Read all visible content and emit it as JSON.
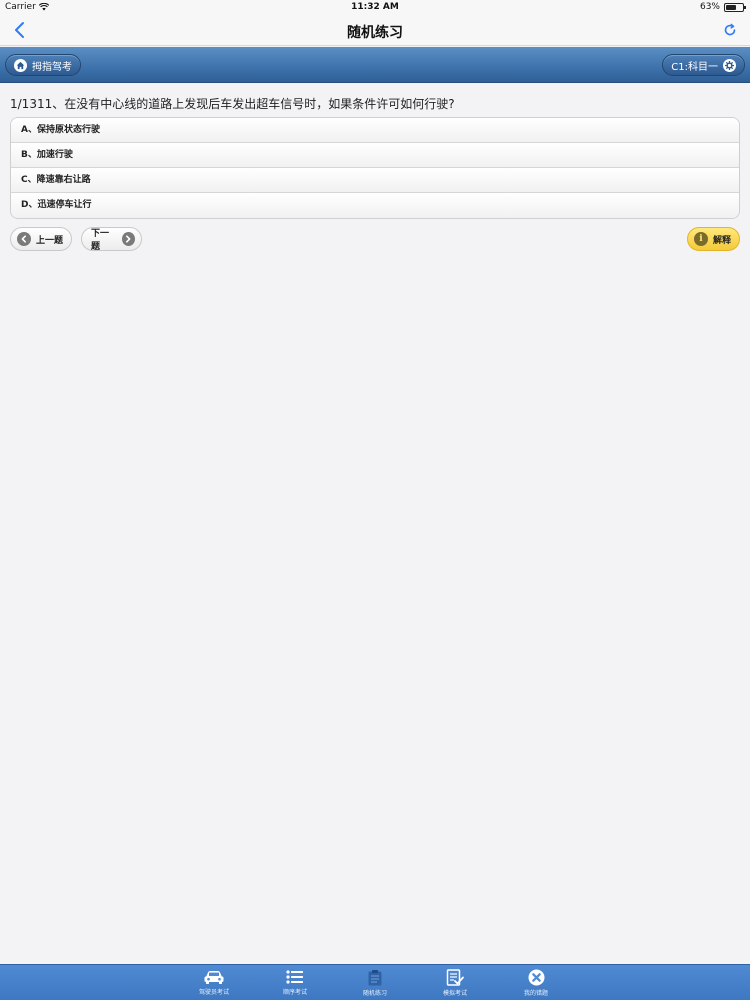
{
  "status": {
    "carrier": "Carrier",
    "time": "11:32 AM",
    "battery_text": "63%",
    "battery_level": 0.63
  },
  "nav": {
    "title": "随机练习"
  },
  "header": {
    "left_label": "拇指驾考",
    "right_label": "C1:科目一"
  },
  "question": {
    "text": "1/1311、在没有中心线的道路上发现后车发出超车信号时，如果条件许可如何行驶?",
    "options": [
      {
        "label": "A、保持原状态行驶"
      },
      {
        "label": "B、加速行驶"
      },
      {
        "label": "C、降速靠右让路"
      },
      {
        "label": "D、迅速停车让行"
      }
    ]
  },
  "actions": {
    "prev_label": "上一题",
    "next_label": "下一题",
    "explain_label": "解释"
  },
  "tabs": [
    {
      "label": "驾驶员考试",
      "icon": "car-icon"
    },
    {
      "label": "顺序考试",
      "icon": "list-icon"
    },
    {
      "label": "随机练习",
      "icon": "clipboard-icon"
    },
    {
      "label": "模拟考试",
      "icon": "exam-sheet-icon"
    },
    {
      "label": "我的错题",
      "icon": "error-x-icon"
    }
  ],
  "colors": {
    "header_blue": "#3f74ad",
    "tab_bar_blue": "#4f8ad3",
    "active_tab_icon": "#2f63a6",
    "explain_yellow": "#f5c93a",
    "ios_blue": "#2f7bf6"
  }
}
